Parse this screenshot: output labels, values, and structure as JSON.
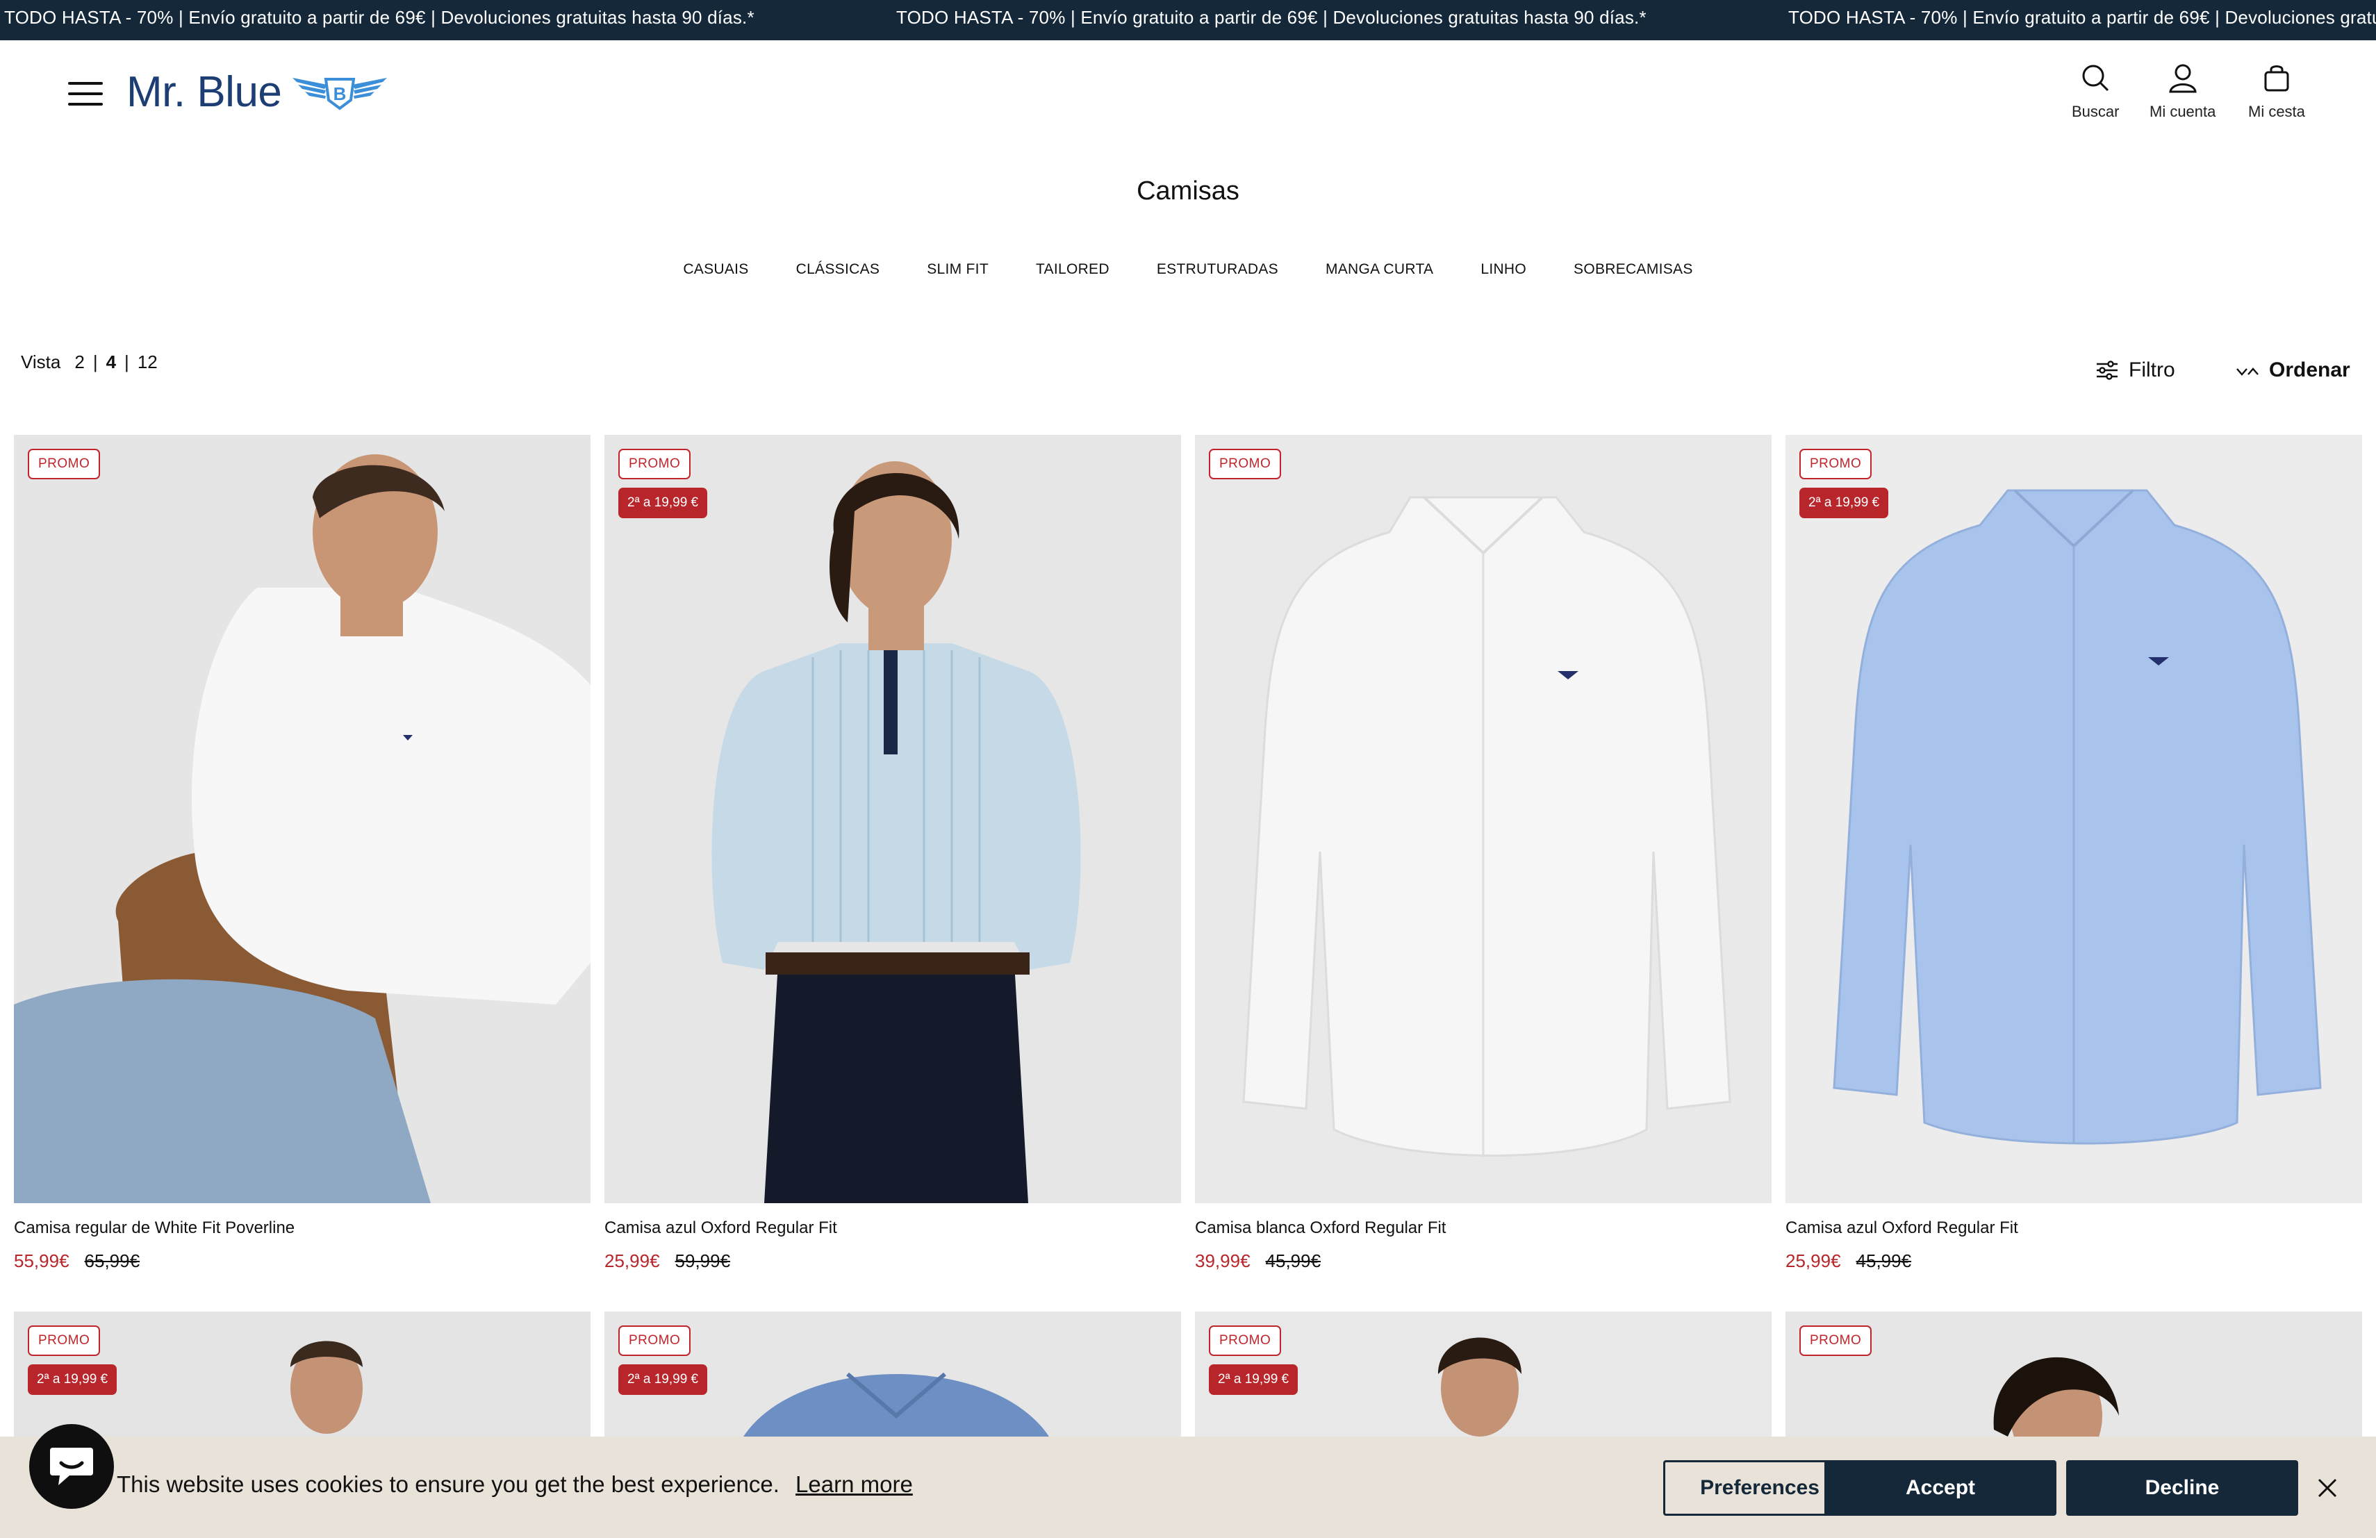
{
  "announcement": {
    "text": "TODO HASTA - 70% | Envío gratuito a partir de 69€ | Devoluciones gratuitas hasta 90 días.*"
  },
  "header": {
    "logo_text": "Mr. Blue",
    "logo_letter": "B",
    "search_label": "Buscar",
    "account_label": "Mi cuenta",
    "cart_label": "Mi cesta"
  },
  "page": {
    "title": "Camisas",
    "subcategories": [
      "CASUAIS",
      "CLÁSSICAS",
      "SLIM FIT",
      "TAILORED",
      "ESTRUTURADAS",
      "MANGA CURTA",
      "LINHO",
      "SOBRECAMISAS"
    ]
  },
  "toolbar": {
    "view_label": "Vista",
    "view_options": [
      "2",
      "4",
      "12"
    ],
    "view_active": "4",
    "filter_label": "Filtro",
    "sort_label": "Ordenar"
  },
  "products": [
    {
      "name": "Camisa regular de White Fit Poverline",
      "price": "55,99€",
      "old_price": "65,99€",
      "badge": "PROMO",
      "badge2": "",
      "shirt_color": "#ffffff"
    },
    {
      "name": "Camisa azul Oxford Regular Fit",
      "price": "25,99€",
      "old_price": "59,99€",
      "badge": "PROMO",
      "badge2": "2ª a 19,99 €",
      "shirt_color": "#cfe0ec"
    },
    {
      "name": "Camisa blanca Oxford Regular Fit",
      "price": "39,99€",
      "old_price": "45,99€",
      "badge": "PROMO",
      "badge2": "",
      "shirt_color": "#f6f6f6"
    },
    {
      "name": "Camisa azul Oxford Regular Fit",
      "price": "25,99€",
      "old_price": "45,99€",
      "badge": "PROMO",
      "badge2": "2ª a 19,99 €",
      "shirt_color": "#a9c4ec"
    }
  ],
  "products_row2": [
    {
      "badge": "PROMO",
      "badge2": "2ª a 19,99 €"
    },
    {
      "badge": "PROMO",
      "badge2": "2ª a 19,99 €"
    },
    {
      "badge": "PROMO",
      "badge2": "2ª a 19,99 €"
    },
    {
      "badge": "PROMO",
      "badge2": ""
    }
  ],
  "cookie": {
    "message": "This website uses cookies to ensure you get the best experience.",
    "learn_more": "Learn more",
    "preferences": "Preferences",
    "accept": "Accept",
    "decline": "Decline"
  },
  "colors": {
    "navy": "#14283a",
    "promo_red": "#b8262b",
    "logo_blue": "#1d3e74",
    "cookie_bg": "#e8e2d8"
  }
}
